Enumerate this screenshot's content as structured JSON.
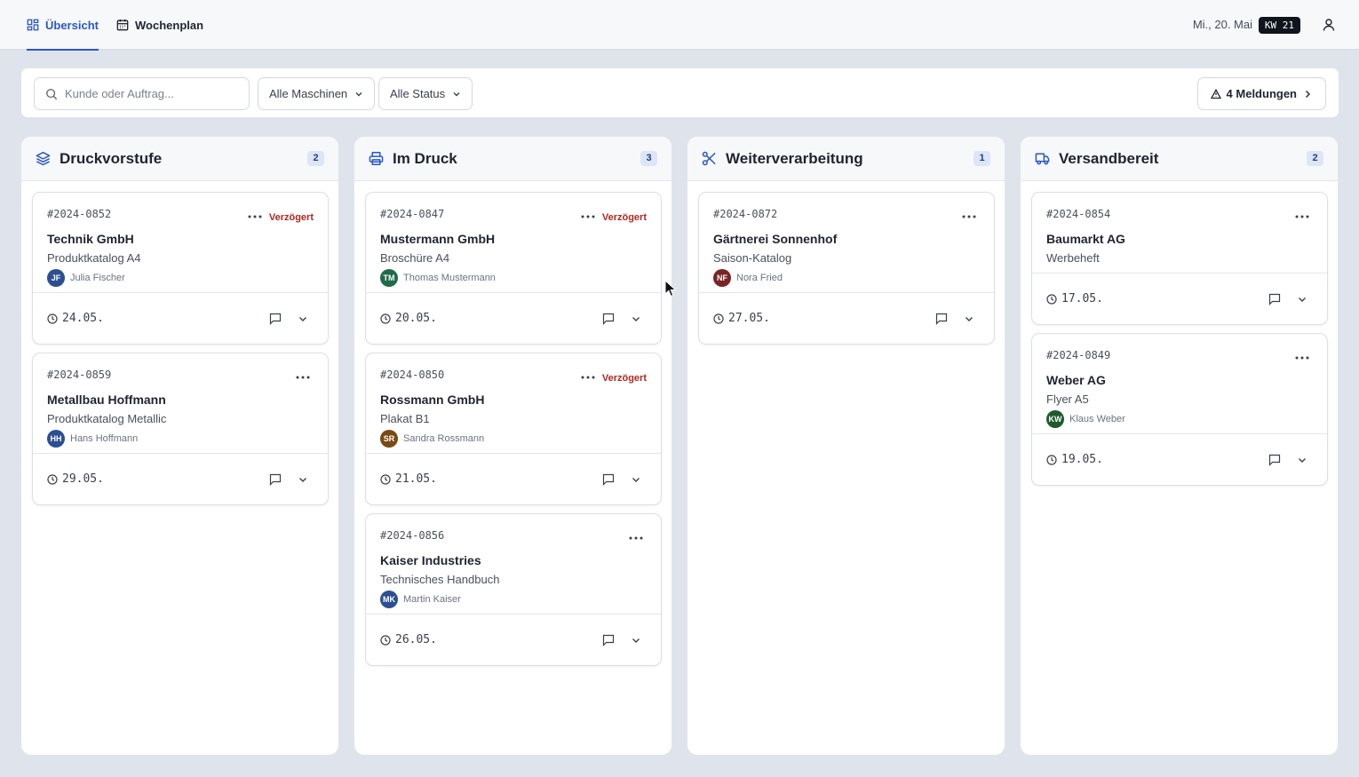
{
  "nav": {
    "tabs": [
      {
        "label": "Übersicht",
        "icon": "dashboard-grid-icon",
        "active": true
      },
      {
        "label": "Wochenplan",
        "icon": "calendar-icon",
        "active": false
      }
    ],
    "date": "Mi., 20. Mai",
    "week_badge": "KW 21",
    "user_icon": "user-icon"
  },
  "filters": {
    "search_placeholder": "Kunde oder Auftrag...",
    "machines": "Alle Maschinen",
    "status": "Alle Status",
    "alerts": "4 Meldungen"
  },
  "colors": {
    "accent": "#2a57c8",
    "delayed": "#b3261e",
    "badge_bg": "#dde6f7"
  },
  "columns": [
    {
      "title": "Druckvorstufe",
      "icon": "layers-icon",
      "count": "2",
      "cards": [
        {
          "id": "#2024-0852",
          "status": "Verzögert",
          "client": "Technik GmbH",
          "product": "Produktkatalog A4",
          "initials": "JF",
          "person": "Julia Fischer",
          "avatar_color": "#2c4f93",
          "due": "24.05."
        },
        {
          "id": "#2024-0859",
          "status": "",
          "client": "Metallbau Hoffmann",
          "product": "Produktkatalog Metallic",
          "initials": "HH",
          "person": "Hans Hoffmann",
          "avatar_color": "#2c4f93",
          "due": "29.05."
        }
      ]
    },
    {
      "title": "Im Druck",
      "icon": "printer-icon",
      "count": "3",
      "cards": [
        {
          "id": "#2024-0847",
          "status": "Verzögert",
          "client": "Mustermann GmbH",
          "product": "Broschüre A4",
          "initials": "TM",
          "person": "Thomas Mustermann",
          "avatar_color": "#1f6b4a",
          "due": "20.05."
        },
        {
          "id": "#2024-0850",
          "status": "Verzögert",
          "client": "Rossmann GmbH",
          "product": "Plakat B1",
          "initials": "SR",
          "person": "Sandra Rossmann",
          "avatar_color": "#7a4a12",
          "due": "21.05."
        },
        {
          "id": "#2024-0856",
          "status": "",
          "client": "Kaiser Industries",
          "product": "Technisches Handbuch",
          "initials": "MK",
          "person": "Martin Kaiser",
          "avatar_color": "#2c4f93",
          "due": "26.05."
        }
      ]
    },
    {
      "title": "Weiterverarbeitung",
      "icon": "scissors-icon",
      "count": "1",
      "cards": [
        {
          "id": "#2024-0872",
          "status": "",
          "client": "Gärtnerei Sonnenhof",
          "product": "Saison-Katalog",
          "initials": "NF",
          "person": "Nora Fried",
          "avatar_color": "#7a2424",
          "due": "27.05."
        }
      ]
    },
    {
      "title": "Versandbereit",
      "icon": "truck-icon",
      "count": "2",
      "cards": [
        {
          "id": "#2024-0854",
          "status": "",
          "client": "Baumarkt AG",
          "product": "Werbeheft",
          "initials": "",
          "person": "",
          "avatar_color": "",
          "due": "17.05."
        },
        {
          "id": "#2024-0849",
          "status": "",
          "client": "Weber AG",
          "product": "Flyer A5",
          "initials": "KW",
          "person": "Klaus Weber",
          "avatar_color": "#1f5a2e",
          "due": "19.05."
        }
      ]
    }
  ]
}
